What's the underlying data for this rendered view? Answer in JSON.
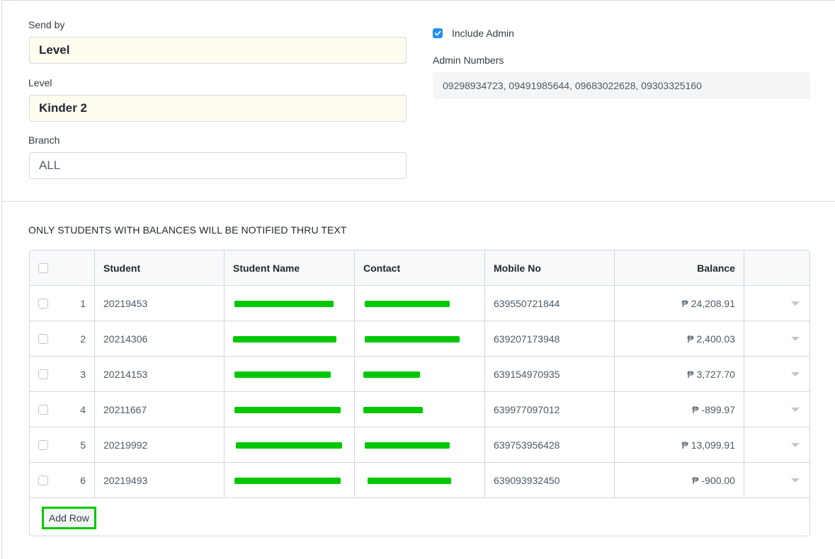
{
  "form": {
    "send_by_label": "Send by",
    "send_by_value": "Level",
    "level_label": "Level",
    "level_value": "Kinder 2",
    "branch_label": "Branch",
    "branch_value": "ALL",
    "include_admin_label": "Include Admin",
    "include_admin_checked": true,
    "admin_numbers_label": "Admin Numbers",
    "admin_numbers_value": "09298934723, 09491985644, 09683022628, 09303325160"
  },
  "notice": "ONLY STUDENTS WITH BALANCES WILL BE NOTIFIED THRU TEXT",
  "table": {
    "headers": [
      "Student",
      "Student Name",
      "Contact",
      "Mobile No",
      "Balance"
    ],
    "rows": [
      {
        "no": "1",
        "student": "20219453",
        "student_name": "",
        "contact": "",
        "mobile": "639550721844",
        "balance": "₱ 24,208.91"
      },
      {
        "no": "2",
        "student": "20214306",
        "student_name": "",
        "contact": "",
        "mobile": "639207173948",
        "balance": "₱ 2,400.03"
      },
      {
        "no": "3",
        "student": "20214153",
        "student_name": "",
        "contact": "",
        "mobile": "639154970935",
        "balance": "₱ 3,727.70"
      },
      {
        "no": "4",
        "student": "20211667",
        "student_name": "",
        "contact": "",
        "mobile": "639977097012",
        "balance": "₱ -899.97"
      },
      {
        "no": "5",
        "student": "20219992",
        "student_name": "",
        "contact": "",
        "mobile": "639753956428",
        "balance": "₱ 13,099.91"
      },
      {
        "no": "6",
        "student": "20219493",
        "student_name": "",
        "contact": "",
        "mobile": "639093932450",
        "balance": "₱ -900.00"
      }
    ],
    "add_row_label": "Add Row"
  },
  "colors": {
    "accent": "#2490ef",
    "redaction": "#00c800",
    "highlight_field": "#fffcf0"
  }
}
